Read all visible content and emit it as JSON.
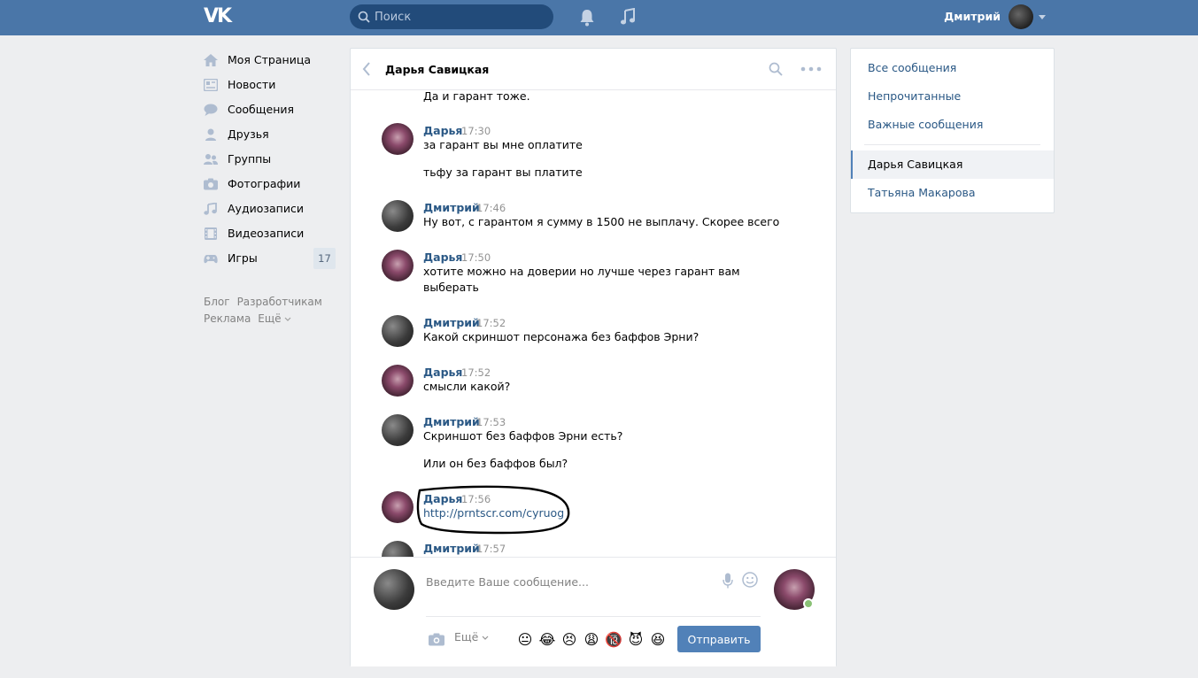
{
  "header": {
    "logo": "VK",
    "search_placeholder": "Поиск",
    "user_name": "Дмитрий"
  },
  "leftnav": {
    "items": [
      {
        "label": "Моя Страница",
        "icon": "home-icon"
      },
      {
        "label": "Новости",
        "icon": "news-icon"
      },
      {
        "label": "Сообщения",
        "icon": "messages-icon"
      },
      {
        "label": "Друзья",
        "icon": "friend-icon"
      },
      {
        "label": "Группы",
        "icon": "groups-icon"
      },
      {
        "label": "Фотографии",
        "icon": "camera-icon"
      },
      {
        "label": "Аудиозаписи",
        "icon": "music-note-icon"
      },
      {
        "label": "Видеозаписи",
        "icon": "film-icon"
      },
      {
        "label": "Игры",
        "icon": "gamepad-icon",
        "badge": "17"
      }
    ],
    "footer": [
      "Блог",
      "Разработчикам",
      "Реклама",
      "Ещё"
    ]
  },
  "chat": {
    "title": "Дарья Савицкая",
    "messages": [
      {
        "sender": "",
        "time": "",
        "lines": [
          "Да и гарант тоже."
        ]
      },
      {
        "sender": "Дарья",
        "time": "17:30",
        "lines": [
          "за гарант вы мне оплатите",
          "тьфу за гарант вы платите"
        ]
      },
      {
        "sender": "Дмитрий",
        "time": "17:46",
        "lines": [
          "Ну вот, с гарантом я сумму в 1500 не выплачу. Скорее всего"
        ]
      },
      {
        "sender": "Дарья",
        "time": "17:50",
        "lines": [
          "хотите можно на доверии но лучше через гарант вам",
          "выберать"
        ]
      },
      {
        "sender": "Дмитрий",
        "time": "17:52",
        "lines": [
          "Какой скриншот персонажа без баффов Эрни?"
        ]
      },
      {
        "sender": "Дарья",
        "time": "17:52",
        "lines": [
          "смысли какой?"
        ]
      },
      {
        "sender": "Дмитрий",
        "time": "17:53",
        "lines": [
          "Скриншот без баффов Эрни есть?",
          "Или он без баффов был?"
        ]
      },
      {
        "sender": "Дарья",
        "time": "17:56",
        "lines": [
          "http://prntscr.com/cyruog"
        ]
      },
      {
        "sender": "Дмитрий",
        "time": "17:57",
        "lines": []
      }
    ],
    "compose": {
      "placeholder": "Введите Ваше сообщение...",
      "more_label": "Ещё",
      "send_label": "Отправить",
      "emojis": [
        "😐",
        "😂",
        "😣",
        "😩",
        "🔞",
        "😈",
        "😆"
      ]
    }
  },
  "rightpanel": {
    "items": [
      "Все сообщения",
      "Непрочитанные",
      "Важные сообщения"
    ],
    "dialogs": [
      "Дарья Савицкая",
      "Татьяна Макарова"
    ],
    "active_dialog": "Дарья Савицкая"
  },
  "colors": {
    "header": "#4a76a8",
    "link": "#2a5885",
    "button": "#5181b8",
    "online": "#8ac176"
  }
}
